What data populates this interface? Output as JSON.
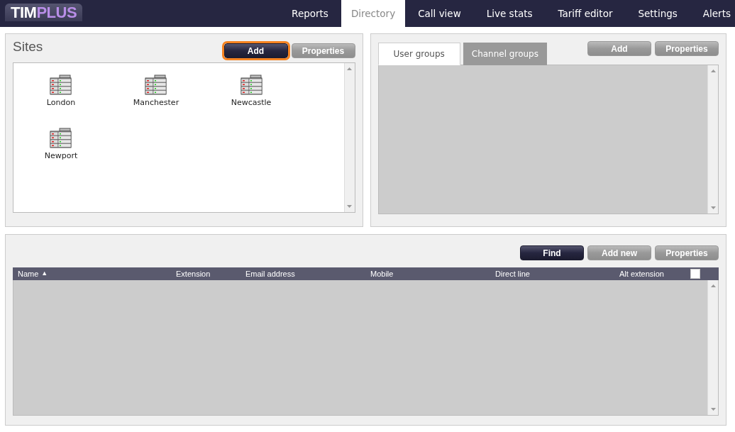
{
  "logo": {
    "parts": [
      {
        "text": "TIM",
        "kind": "plain"
      },
      {
        "text": "PLUS",
        "kind": "accent"
      }
    ]
  },
  "nav": [
    {
      "label": "Reports",
      "selected": false
    },
    {
      "label": "Directory",
      "selected": true
    },
    {
      "label": "Call view",
      "selected": false
    },
    {
      "label": "Live stats",
      "selected": false
    },
    {
      "label": "Tariff editor",
      "selected": false
    },
    {
      "label": "Settings",
      "selected": false
    },
    {
      "label": "Alerts",
      "selected": false
    }
  ],
  "sites": {
    "title": "Sites",
    "buttons": [
      {
        "label": "Add",
        "kind": "primary",
        "focused": true
      },
      {
        "label": "Properties",
        "kind": "secondary",
        "focused": false
      }
    ],
    "items": [
      {
        "name": "London"
      },
      {
        "name": "Manchester"
      },
      {
        "name": "Newcastle"
      },
      {
        "name": "Newport"
      }
    ]
  },
  "groups": {
    "tabs": [
      {
        "label": "User groups",
        "selected": true
      },
      {
        "label": "Channel groups",
        "selected": false
      }
    ],
    "buttons": [
      {
        "label": "Add",
        "kind": "secondary",
        "focused": false
      },
      {
        "label": "Properties",
        "kind": "secondary",
        "focused": false
      }
    ]
  },
  "directory": {
    "buttons": [
      {
        "label": "Find",
        "kind": "primary",
        "focused": false
      },
      {
        "label": "Add new",
        "kind": "secondary",
        "focused": false
      },
      {
        "label": "Properties",
        "kind": "secondary",
        "focused": false
      }
    ],
    "columns": [
      {
        "label": "Name",
        "sort": "▲"
      },
      {
        "label": "Extension"
      },
      {
        "label": "Email address"
      },
      {
        "label": "Mobile"
      },
      {
        "label": "Direct line"
      },
      {
        "label": "Alt extension"
      }
    ],
    "select_all": {
      "checked": false
    }
  }
}
